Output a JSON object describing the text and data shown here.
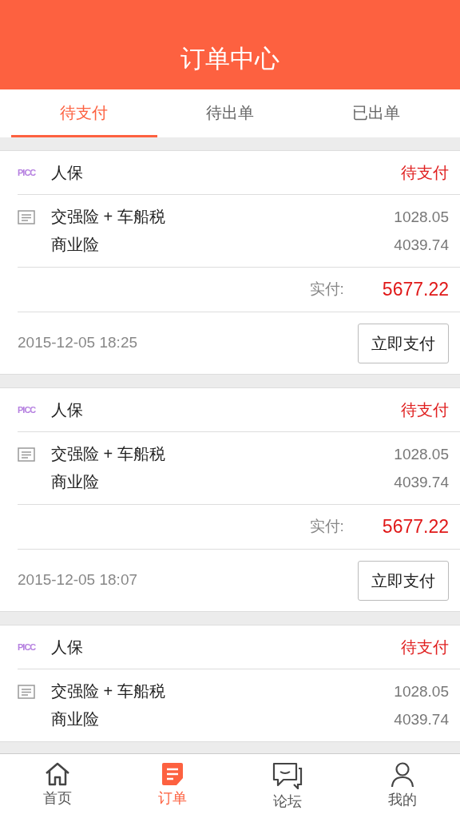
{
  "header": {
    "title": "订单中心"
  },
  "tabs": [
    {
      "label": "待支付",
      "selected": true
    },
    {
      "label": "待出单",
      "selected": false
    },
    {
      "label": "已出单",
      "selected": false
    }
  ],
  "orders": [
    {
      "logo": "PICC",
      "company": "人保",
      "status": "待支付",
      "items": [
        {
          "name": "交强险 + 车船税",
          "amount": "1028.05"
        },
        {
          "name": "商业险",
          "amount": "4039.74"
        }
      ],
      "total_label": "实付:",
      "total": "5677.22",
      "time": "2015-12-05 18:25",
      "action": "立即支付"
    },
    {
      "logo": "PICC",
      "company": "人保",
      "status": "待支付",
      "items": [
        {
          "name": "交强险 + 车船税",
          "amount": "1028.05"
        },
        {
          "name": "商业险",
          "amount": "4039.74"
        }
      ],
      "total_label": "实付:",
      "total": "5677.22",
      "time": "2015-12-05 18:07",
      "action": "立即支付"
    },
    {
      "logo": "PICC",
      "company": "人保",
      "status": "待支付",
      "items": [
        {
          "name": "交强险 + 车船税",
          "amount": "1028.05"
        },
        {
          "name": "商业险",
          "amount": "4039.74"
        }
      ]
    }
  ],
  "bottom_nav": [
    {
      "label": "首页",
      "kind": "home",
      "selected": false
    },
    {
      "label": "订单",
      "kind": "orders",
      "selected": true
    },
    {
      "label": "论坛",
      "kind": "forum",
      "selected": false
    },
    {
      "label": "我的",
      "kind": "profile",
      "selected": false
    }
  ]
}
